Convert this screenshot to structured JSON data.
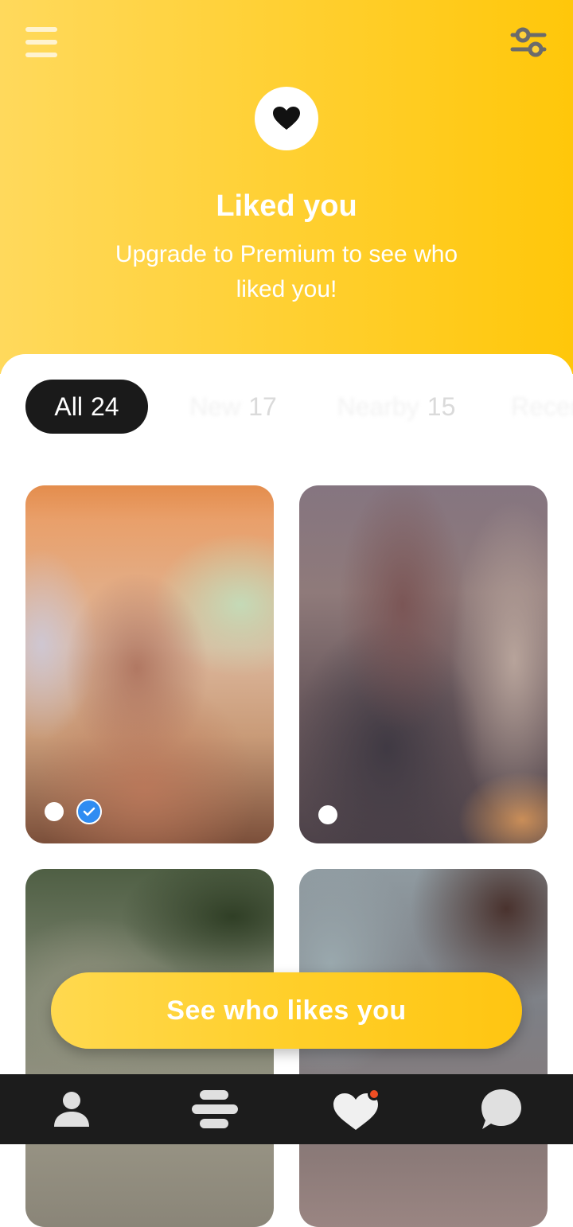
{
  "header": {
    "menu_icon": "hamburger-menu-icon",
    "filter_icon": "sliders-icon",
    "badge_icon": "heart-icon",
    "title": "Liked you",
    "subtitle": "Upgrade to Premium to see who liked you!"
  },
  "tabs": [
    {
      "label": "All",
      "count": "24",
      "active": true
    },
    {
      "label": "New",
      "count": "17",
      "active": false
    },
    {
      "label": "Nearby",
      "count": "15",
      "active": false
    },
    {
      "label": "Recent",
      "count": "",
      "active": false
    }
  ],
  "cards": [
    {
      "name": "liker-card-1",
      "online": true,
      "verified": true
    },
    {
      "name": "liker-card-2",
      "online": true,
      "verified": false
    },
    {
      "name": "liker-card-3",
      "online": false,
      "verified": false
    },
    {
      "name": "liker-card-4",
      "online": false,
      "verified": false
    }
  ],
  "cta": {
    "label": "See who likes you"
  },
  "nav": [
    {
      "icon": "profile-icon"
    },
    {
      "icon": "people-nearby-icon"
    },
    {
      "icon": "liked-you-icon",
      "has_notification": true
    },
    {
      "icon": "chat-icon"
    }
  ],
  "colors": {
    "accent": "#ffc70a",
    "verified": "#2f8cf2",
    "nav_background": "#1c1c1c",
    "notification": "#f04e23"
  }
}
